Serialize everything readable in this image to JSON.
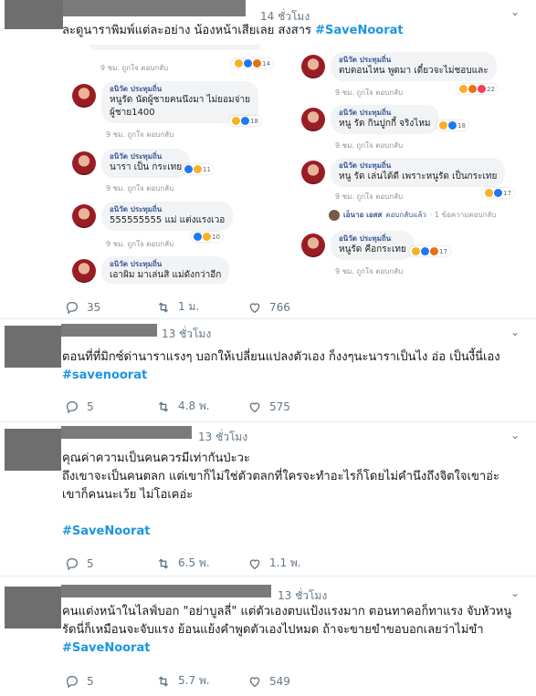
{
  "tweets": [
    {
      "time": "14 ชั่วโมง",
      "text": "ละดูนาราพิมพ์แต่ละอย่าง น้องหน้าเสียเลย สงสาร",
      "hashtag": "#SaveNoorat",
      "replies": "35",
      "retweets": "1 ม.",
      "likes": "766",
      "embedded": {
        "left": [
          {
            "name": "",
            "msg": "",
            "sub": "9 ชม.   ถูกใจ   ตอบกลับ",
            "react": "14"
          },
          {
            "name": "อนิวัต ประทุมถิ่น",
            "msg": "หนูรัด นัดผู้ชายคนนึงมา ไม่ยอมจ่าย",
            "msg2": "ผู้ชาย1400",
            "sub": "9 ชม.   ถูกใจ   ตอบกลับ",
            "react": "18"
          },
          {
            "name": "อนิวัต ประทุมถิ่น",
            "msg": "นารา เป็น กระเทย",
            "sub": "9 ชม.   ถูกใจ   ตอบกลับ",
            "react": "11"
          },
          {
            "name": "อนิวัต ประทุมถิ่น",
            "msg": "555555555 แม่ แต่งแรงเวอ",
            "sub": "9 ชม.   ถูกใจ   ตอบกลับ",
            "react": "10"
          },
          {
            "name": "อนิวัต ประทุมถิ่น",
            "msg": "เอาผิม มาเล่นสิ แม่ดังกว่าอีก",
            "sub": "",
            "react": ""
          }
        ],
        "right": [
          {
            "name": "อนิวัต ประทุมถิ่น",
            "msg": "ตบตอนไหน พูดมา เดี๋ยวจะไม่ชอบและ",
            "sub": "9 ชม.   ถูกใจ   ตอบกลับ",
            "react": "22"
          },
          {
            "name": "อนิวัต ประทุมถิ่น",
            "msg": "หนู รัด กินปูกกี้ จริงไหม",
            "sub": "9 ชม.   ถูกใจ   ตอบกลับ",
            "react": "18"
          },
          {
            "name": "อนิวัต ประทุมถิ่น",
            "msg": "หนู รัด เล่นได้ดี เพราะหนูรัด เป็นกระเทย",
            "sub": "9 ชม.   ถูกใจ   ตอบกลับ",
            "react": "17"
          },
          {
            "name": "อนิวัต ประทุมถิ่น",
            "msg": "หนูรัด คือกระเทย",
            "sub": "9 ชม.   ถูกใจ   ตอบกลับ",
            "react": "17"
          }
        ],
        "reply_line": {
          "name": "เอ็นาอ เอสส",
          "action": "ตอบกลับแล้ว",
          "count": "· 1 ข้อความตอบกลับ"
        }
      }
    },
    {
      "time": "13 ชั่วโมง",
      "text": "ตอนที่ที่มิกซ์ด่านาราแรงๆ บอกให้เปลี่ยนแปลงตัวเอง ก็งงๆนะนาราเป็นไง อ่อ เป็นงี้นี่เอง",
      "hashtag": "#savenoorat",
      "replies": "5",
      "retweets": "4.8 พ.",
      "likes": "575"
    },
    {
      "time": "13 ชั่วโมง",
      "line1": "คุณค่าความเป็นคนควรมีเท่ากันป่ะวะ",
      "line2": "ถึงเขาจะเป็นคนตลก แต่เขาก็ไม่ใช่ตัวตลกที่ใครจะทำอะไรก็โดยไม่คำนึงถึงจิตใจเขาอ่ะ",
      "line3": "เขาก็คนนะเว้ย ไม่โอเคอ่ะ",
      "hashtag": "#SaveNoorat",
      "replies": "5",
      "retweets": "6.5 พ.",
      "likes": "1.1 พ."
    },
    {
      "time": "13 ชั่วโมง",
      "line1": "คนแต่งหน้าในไลฟ์บอก \"อย่าบูลลี่\" แต่ตัวเองตบแป้งแรงมาก ตอนทาคอก็ทาแรง จับหัวหนู",
      "line2": "รัดนี่ก็เหมือนจะจับแรง ย้อนแย้งคำพูดตัวเองไปหมด ถ้าจะขายขำขอบอกเลยว่าไม่ขำ",
      "hashtag": "#SaveNoorat",
      "replies": "5",
      "retweets": "5.7 พ.",
      "likes": "549"
    }
  ],
  "colors": {
    "hashtag": "#1b95e0",
    "meta": "#657786",
    "text": "#14171a",
    "divider": "#e6ecf0"
  }
}
